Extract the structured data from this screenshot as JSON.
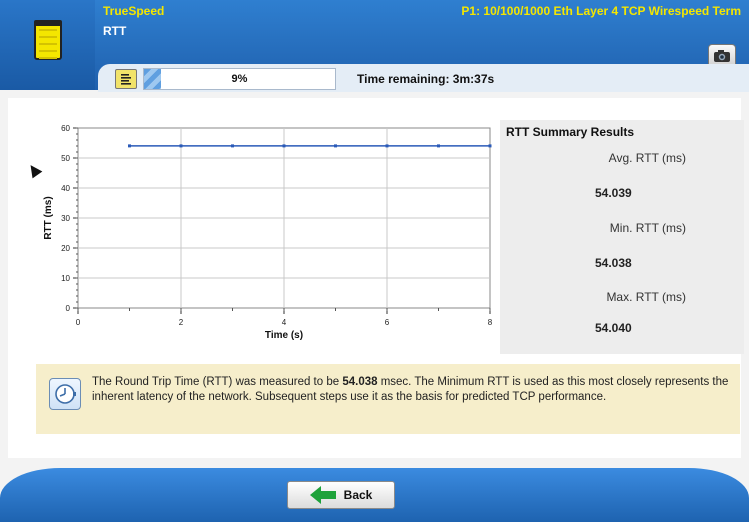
{
  "header": {
    "app_name": "TrueSpeed",
    "step_name": "RTT",
    "test_name": "P1: 10/100/1000 Eth Layer 4 TCP Wirespeed Term"
  },
  "progress": {
    "percent_label": "9%",
    "fraction": 0.09,
    "time_remaining": "Time remaining: 3m:37s"
  },
  "summary": {
    "title": "RTT Summary Results",
    "avg_label": "Avg. RTT (ms)",
    "avg_value": "54.039",
    "min_label": "Min. RTT (ms)",
    "min_value": "54.038",
    "max_label": "Max. RTT (ms)",
    "max_value": "54.040"
  },
  "info": {
    "text_before": "The Round Trip Time (RTT) was measured to be ",
    "text_bold": "54.038",
    "text_after": " msec. The Minimum RTT is used as this most closely represents the inherent latency of the network. Subsequent steps use it as the basis for predicted TCP performance."
  },
  "footer": {
    "back_label": "Back"
  },
  "icons": {
    "device": "device-icon",
    "camera": "camera-icon",
    "report": "report-icon",
    "clock": "clock-icon",
    "back_arrow": "arrow-left-icon"
  },
  "colors": {
    "header_blue": "#1f60ad",
    "title_yellow": "#f4e600",
    "series_blue": "#2a5ab8",
    "back_arrow_green": "#1ea23a"
  },
  "chart_data": {
    "type": "line",
    "xlabel": "Time (s)",
    "ylabel": "RTT (ms)",
    "xlim": [
      0,
      8
    ],
    "ylim": [
      0,
      60
    ],
    "x_ticks": [
      0,
      2,
      4,
      6,
      8
    ],
    "y_ticks": [
      0,
      10,
      20,
      30,
      40,
      50,
      60
    ],
    "grid": true,
    "series": [
      {
        "x": [
          1,
          2,
          3,
          4,
          5,
          6,
          7,
          8
        ],
        "y": [
          54.04,
          54.04,
          54.04,
          54.04,
          54.04,
          54.04,
          54.04,
          54.04
        ]
      }
    ]
  }
}
